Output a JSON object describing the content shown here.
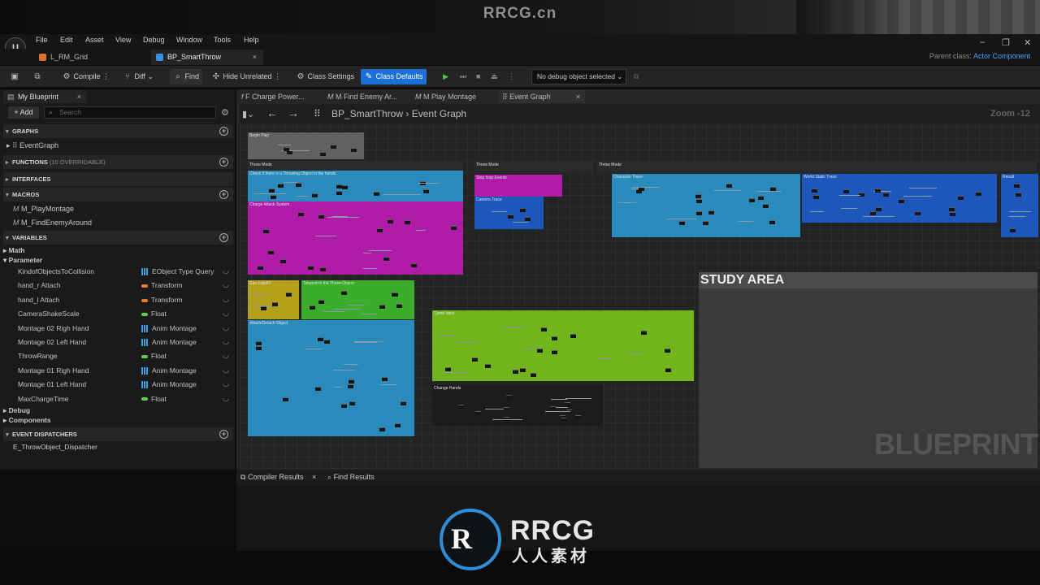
{
  "watermark_top": "RRCG.cn",
  "menu": [
    "File",
    "Edit",
    "Asset",
    "View",
    "Debug",
    "Window",
    "Tools",
    "Help"
  ],
  "tabs": [
    {
      "label": "L_RM_Grid",
      "color": "#e07030"
    },
    {
      "label": "BP_SmartThrow",
      "color": "#3a8ee6",
      "close": "×"
    }
  ],
  "parent_class": {
    "label": "Parent class:",
    "value": "Actor Component"
  },
  "window": {
    "min": "–",
    "max": "❐",
    "close": "✕"
  },
  "toolbar": {
    "compile": "Compile",
    "diff": "Diff",
    "find": "Find",
    "hide_unrelated": "Hide Unrelated",
    "class_settings": "Class Settings",
    "class_defaults": "Class Defaults",
    "debug_object": "No debug object selected"
  },
  "my_blueprint": {
    "tab": "My Blueprint",
    "add": "+ Add",
    "search_placeholder": "Search",
    "graphs": {
      "title": "GRAPHS",
      "items": [
        "EventGraph"
      ]
    },
    "functions": {
      "title": "FUNCTIONS",
      "count": "(10 OVERRIDABLE)"
    },
    "interfaces": {
      "title": "INTERFACES"
    },
    "macros": {
      "title": "MACROS",
      "items": [
        "M_PlayMontage",
        "M_FindEnemyAround"
      ]
    },
    "variables": {
      "title": "VARIABLES",
      "categories": [
        "Math",
        "Parameter"
      ],
      "items": [
        {
          "name": "KindofObjectsToCollision",
          "type": "EObject Type Query",
          "color": "grid"
        },
        {
          "name": "hand_r Attach",
          "type": "Transform",
          "color": "#f07a22"
        },
        {
          "name": "hand_l Attach",
          "type": "Transform",
          "color": "#f07a22"
        },
        {
          "name": "CameraShakeScale",
          "type": "Float",
          "color": "#5bd14a"
        },
        {
          "name": "Montage 02 Righ Hand",
          "type": "Anim Montage",
          "color": "grid"
        },
        {
          "name": "Montage 02 Left Hand",
          "type": "Anim Montage",
          "color": "grid"
        },
        {
          "name": "ThrowRange",
          "type": "Float",
          "color": "#5bd14a"
        },
        {
          "name": "Montage 01 Righ Hand",
          "type": "Anim Montage",
          "color": "grid"
        },
        {
          "name": "Montage 01 Left Hand",
          "type": "Anim Montage",
          "color": "grid"
        },
        {
          "name": "MaxChargeTime",
          "type": "Float",
          "color": "#5bd14a"
        }
      ],
      "more_categories": [
        "Debug",
        "Components"
      ]
    },
    "event_dispatchers": {
      "title": "EVENT DISPATCHERS",
      "items": [
        "E_ThrowObject_Dispatcher"
      ]
    }
  },
  "graph_tabs": [
    "F Charge Power...",
    "M Find Enemy Ar...",
    "M Play Montage",
    "Event Graph"
  ],
  "breadcrumb": {
    "bp": "BP_SmartThrow",
    "graph": "Event Graph",
    "sep": "›"
  },
  "zoom": "Zoom -12",
  "comment_boxes": [
    "Begin Play",
    "Throw Mode",
    "Check if there is a Throwing Object in the hands",
    "Charge Attack System",
    "Throw Mode",
    "Stop loop Events",
    "Camera Trace",
    "Throw Mode",
    "Character Trace",
    "World Static Trace",
    "Result",
    "Can Catch?",
    "Teleport to the Throw Object",
    "Attach/Detach Object",
    "Come back",
    "Change Hands"
  ],
  "study_area": {
    "title": "STUDY AREA",
    "watermark": "BLUEPRINT"
  },
  "bottom_tabs": [
    "Compiler Results",
    "Find Results"
  ],
  "footer": {
    "brand": "RRCG",
    "sub": "人人素材",
    "mark": "R"
  }
}
